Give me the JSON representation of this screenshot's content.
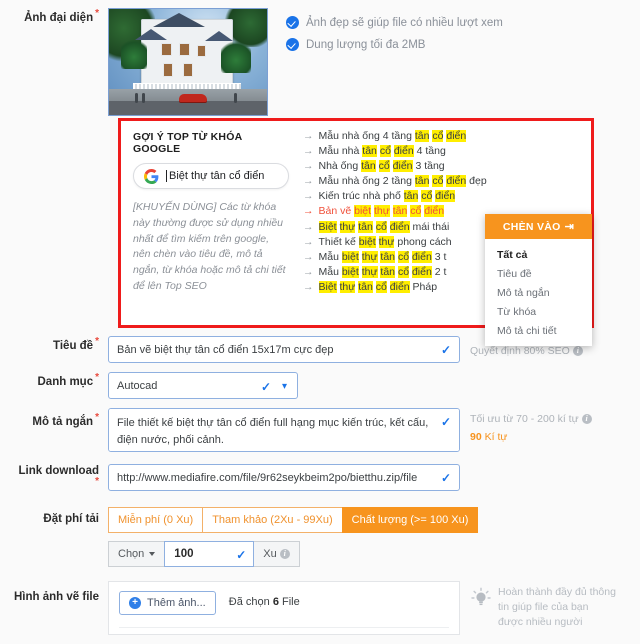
{
  "avatar": {
    "label": "Ảnh đại diện",
    "required": true,
    "image_alt": "biet-thu-tan-co-dien-thumbnail",
    "hints": [
      "Ảnh đẹp sẽ giúp file có nhiều lượt xem",
      "Dung lượng tối đa 2MB"
    ]
  },
  "keyword_box": {
    "title": "GỢI Ý TOP TỪ KHÓA GOOGLE",
    "search_value": "Biệt thự tân cổ điển",
    "note": "[KHUYẾN DÙNG] Các từ khóa này thường được sử dụng nhiều nhất để tìm kiếm trên google, nên chèn vào tiêu đề, mô tả ngắn, từ khóa hoặc mô tả chi tiết để lên Top SEO",
    "border_color": "#ef1b1b",
    "highlight_color": "#ffee00",
    "selected_color": "#f0503a",
    "items": [
      {
        "selected": false,
        "parts": [
          {
            "t": "Mẫu nhà ống 4 tầng ",
            "h": false
          },
          {
            "t": "tân",
            "h": true
          },
          {
            "t": " ",
            "h": false
          },
          {
            "t": "cổ",
            "h": true
          },
          {
            "t": " ",
            "h": false
          },
          {
            "t": "điển",
            "h": true
          }
        ]
      },
      {
        "selected": false,
        "parts": [
          {
            "t": "Mẫu nhà ",
            "h": false
          },
          {
            "t": "tân",
            "h": true
          },
          {
            "t": " ",
            "h": false
          },
          {
            "t": "cổ",
            "h": true
          },
          {
            "t": " ",
            "h": false
          },
          {
            "t": "điển",
            "h": true
          },
          {
            "t": " 4 tầng",
            "h": false
          }
        ]
      },
      {
        "selected": false,
        "parts": [
          {
            "t": "Nhà ống ",
            "h": false
          },
          {
            "t": "tân",
            "h": true
          },
          {
            "t": " ",
            "h": false
          },
          {
            "t": "cổ",
            "h": true
          },
          {
            "t": " ",
            "h": false
          },
          {
            "t": "điển",
            "h": true
          },
          {
            "t": " 3 tầng",
            "h": false
          }
        ]
      },
      {
        "selected": false,
        "parts": [
          {
            "t": "Mẫu nhà ống 2 tầng ",
            "h": false
          },
          {
            "t": "tân",
            "h": true
          },
          {
            "t": " ",
            "h": false
          },
          {
            "t": "cổ",
            "h": true
          },
          {
            "t": " ",
            "h": false
          },
          {
            "t": "điển",
            "h": true
          },
          {
            "t": " đẹp",
            "h": false
          }
        ]
      },
      {
        "selected": false,
        "parts": [
          {
            "t": "Kiến trúc nhà phố ",
            "h": false
          },
          {
            "t": "tân",
            "h": true
          },
          {
            "t": " ",
            "h": false
          },
          {
            "t": "cổ",
            "h": true
          },
          {
            "t": " ",
            "h": false
          },
          {
            "t": "điển",
            "h": true
          }
        ]
      },
      {
        "selected": true,
        "parts": [
          {
            "t": "Bản vẽ ",
            "h": false
          },
          {
            "t": "biệt",
            "h": true
          },
          {
            "t": " ",
            "h": false
          },
          {
            "t": "thự",
            "h": true
          },
          {
            "t": " ",
            "h": false
          },
          {
            "t": "tân",
            "h": true
          },
          {
            "t": " ",
            "h": false
          },
          {
            "t": "cổ",
            "h": true
          },
          {
            "t": " ",
            "h": false
          },
          {
            "t": "điển",
            "h": true
          }
        ]
      },
      {
        "selected": false,
        "parts": [
          {
            "t": "Biệt",
            "h": true
          },
          {
            "t": " ",
            "h": false
          },
          {
            "t": "thự",
            "h": true
          },
          {
            "t": " ",
            "h": false
          },
          {
            "t": "tân",
            "h": true
          },
          {
            "t": " ",
            "h": false
          },
          {
            "t": "cổ",
            "h": true
          },
          {
            "t": " ",
            "h": false
          },
          {
            "t": "điển",
            "h": true
          },
          {
            "t": " mái thái",
            "h": false
          }
        ]
      },
      {
        "selected": false,
        "parts": [
          {
            "t": "Thiết kế ",
            "h": false
          },
          {
            "t": "biệt",
            "h": true
          },
          {
            "t": " ",
            "h": false
          },
          {
            "t": "thự",
            "h": true
          },
          {
            "t": " phong cách",
            "h": false
          }
        ]
      },
      {
        "selected": false,
        "parts": [
          {
            "t": "Mẫu ",
            "h": false
          },
          {
            "t": "biệt",
            "h": true
          },
          {
            "t": " ",
            "h": false
          },
          {
            "t": "thự",
            "h": true
          },
          {
            "t": " ",
            "h": false
          },
          {
            "t": "tân",
            "h": true
          },
          {
            "t": " ",
            "h": false
          },
          {
            "t": "cổ",
            "h": true
          },
          {
            "t": " ",
            "h": false
          },
          {
            "t": "điển",
            "h": true
          },
          {
            "t": " 3 t",
            "h": false
          }
        ]
      },
      {
        "selected": false,
        "parts": [
          {
            "t": "Mẫu ",
            "h": false
          },
          {
            "t": "biệt",
            "h": true
          },
          {
            "t": " ",
            "h": false
          },
          {
            "t": "thự",
            "h": true
          },
          {
            "t": " ",
            "h": false
          },
          {
            "t": "tân",
            "h": true
          },
          {
            "t": " ",
            "h": false
          },
          {
            "t": "cổ",
            "h": true
          },
          {
            "t": " ",
            "h": false
          },
          {
            "t": "điển",
            "h": true
          },
          {
            "t": " 2 t",
            "h": false
          }
        ]
      },
      {
        "selected": false,
        "parts": [
          {
            "t": "Biệt",
            "h": true
          },
          {
            "t": " ",
            "h": false
          },
          {
            "t": "thự",
            "h": true
          },
          {
            "t": " ",
            "h": false
          },
          {
            "t": "tân",
            "h": true
          },
          {
            "t": " ",
            "h": false
          },
          {
            "t": "cổ",
            "h": true
          },
          {
            "t": " ",
            "h": false
          },
          {
            "t": "điển",
            "h": true
          },
          {
            "t": " Pháp",
            "h": false
          }
        ]
      }
    ]
  },
  "insert_dropdown": {
    "header": "CHÈN VÀO",
    "header_icon": "insert-arrow-icon",
    "header_color": "#f7941e",
    "options": [
      {
        "label": "Tất cả",
        "active": true
      },
      {
        "label": "Tiêu đề",
        "active": false
      },
      {
        "label": "Mô tả ngắn",
        "active": false
      },
      {
        "label": "Từ khóa",
        "active": false
      },
      {
        "label": "Mô tả chi tiết",
        "active": false
      }
    ]
  },
  "form": {
    "title": {
      "label": "Tiêu đề",
      "required": true,
      "value": "Bản vẽ biệt thự tân cổ điển 15x17m cực đẹp",
      "valid": true,
      "side_note": "Quyết định 80% SEO"
    },
    "category": {
      "label": "Danh mục",
      "required": true,
      "value": "Autocad",
      "valid": true
    },
    "short_desc": {
      "label": "Mô tả ngắn",
      "required": true,
      "value": "File thiết kế biệt thự tân cổ điển full hạng mục kiến trúc, kết cấu, điện nước, phối cảnh.",
      "valid": true,
      "side_note": "Tối ưu từ 70 - 200 kí tự",
      "counter_number": "90",
      "counter_unit": "Kí tự"
    },
    "download_link": {
      "label": "Link download",
      "required": true,
      "value": "http://www.mediafire.com/file/9r62seykbeim2po/bietthu.zip/file",
      "valid": true
    },
    "fee": {
      "label": "Đặt phí tải",
      "options": [
        {
          "label": "Miễn phí (0 Xu)",
          "selected": false
        },
        {
          "label": "Tham khảo (2Xu - 99Xu)",
          "selected": false
        },
        {
          "label": "Chất lượng (>= 100 Xu)",
          "selected": true
        }
      ],
      "chon_label": "Chọn",
      "amount": "100",
      "amount_valid": true,
      "unit_label": "Xu"
    },
    "images": {
      "label": "Hình ảnh vẽ file",
      "add_button": "Thêm ảnh...",
      "chosen_prefix": "Đã chọn",
      "chosen_count": "6",
      "chosen_suffix": "File"
    }
  },
  "bottom_note": {
    "icon": "lightbulb-icon",
    "text": "Hoàn thành đầy đủ thông tin giúp file của bạn được nhiều người"
  }
}
